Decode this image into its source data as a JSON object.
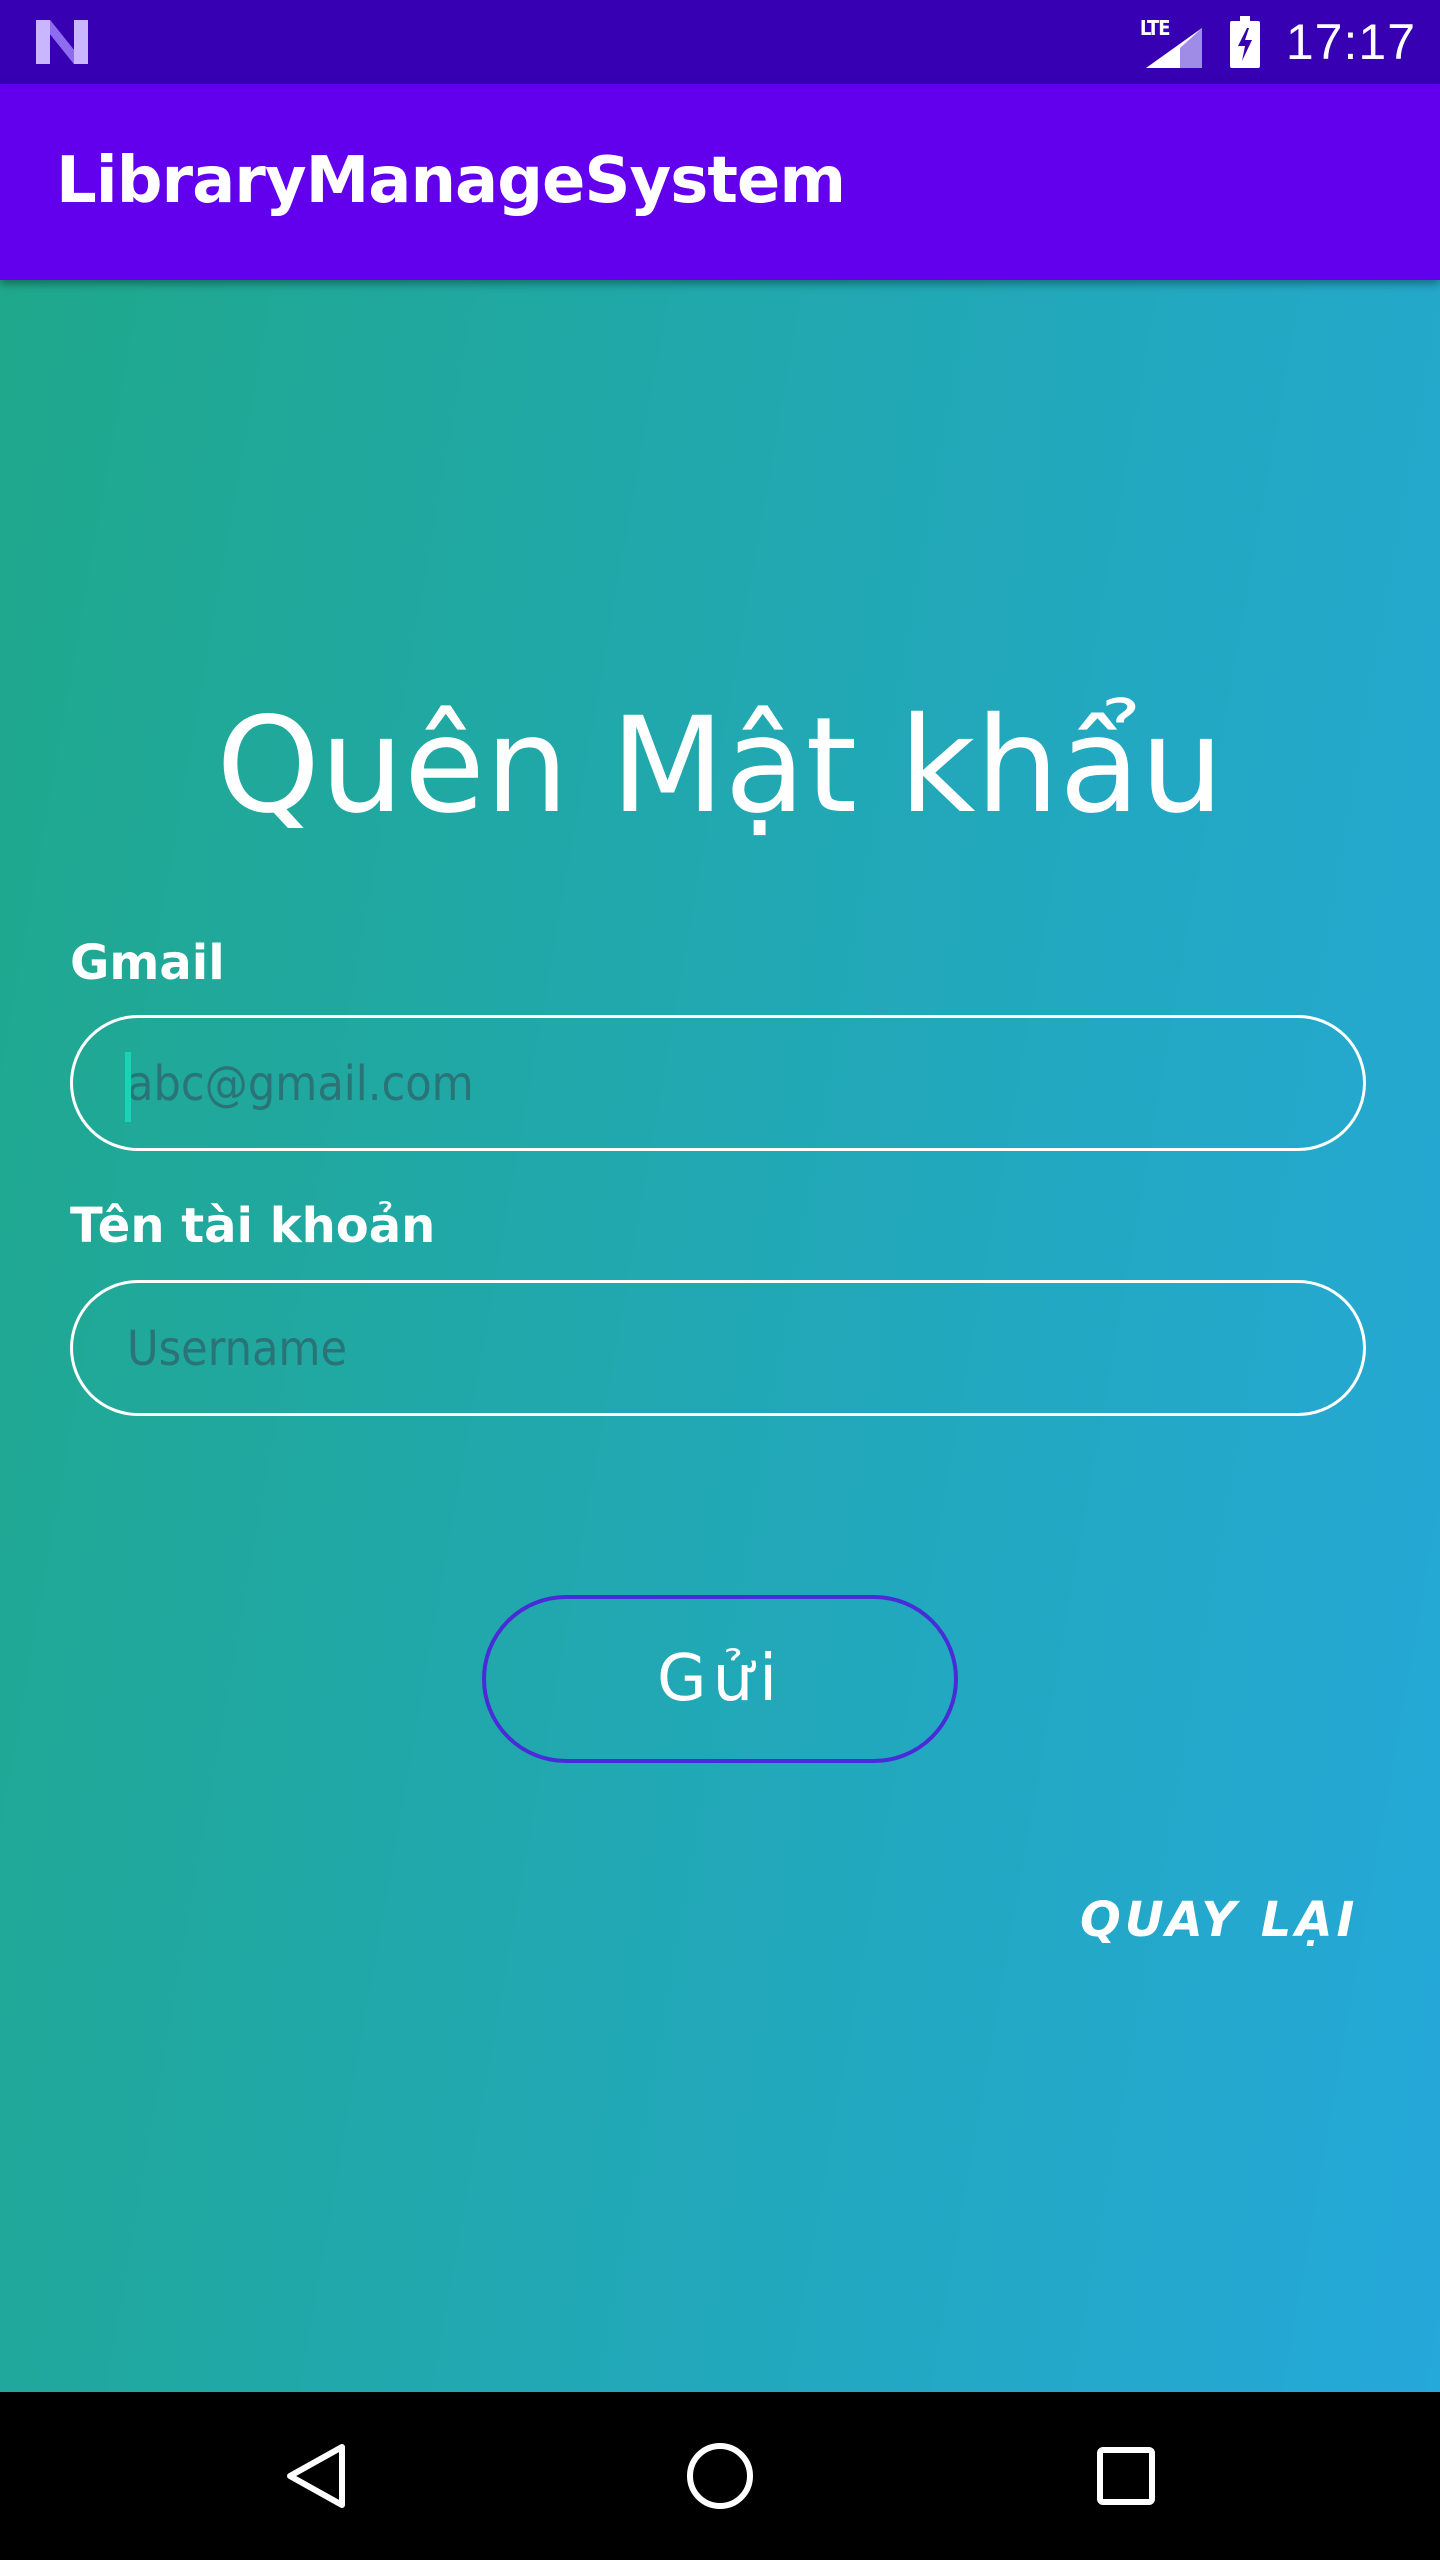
{
  "status_bar": {
    "network_label": "LTE",
    "time": "17:17",
    "icons": [
      "android-n-logo-icon",
      "signal-icon",
      "battery-charging-icon"
    ]
  },
  "app_bar": {
    "title": "LibraryManageSystem"
  },
  "form": {
    "heading": "Quên Mật khẩu",
    "gmail": {
      "label": "Gmail",
      "value": "",
      "placeholder": "abc@gmail.com"
    },
    "username": {
      "label": "Tên tài khoản",
      "value": "",
      "placeholder": "Username"
    },
    "submit_label": "Gửi",
    "back_label": "QUAY LẠI"
  },
  "nav_bar": {
    "icons": [
      "back-triangle-icon",
      "home-circle-icon",
      "recents-square-icon"
    ]
  },
  "colors": {
    "status_bar": "#3700B3",
    "app_bar": "#6200EE",
    "gradient_start": "#1FA88B",
    "gradient_end": "#25A8DA",
    "button_border": "#4A2BD8",
    "cursor": "#19D3B5"
  }
}
